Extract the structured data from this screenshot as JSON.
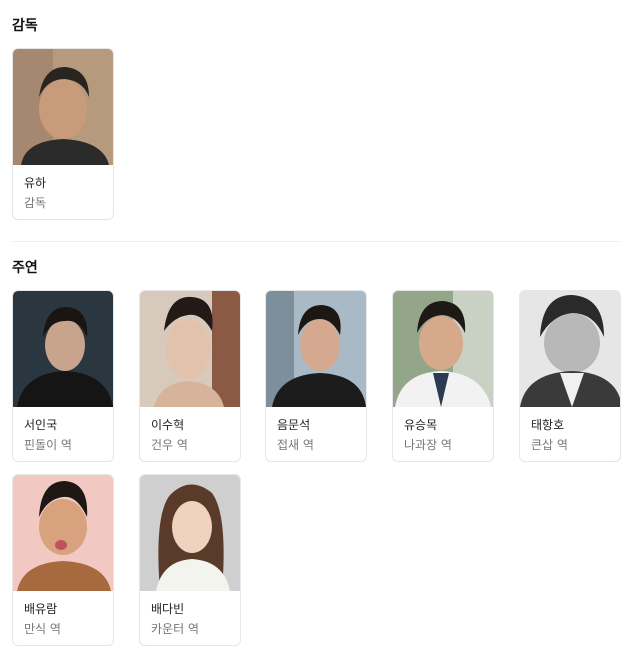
{
  "director_section": {
    "title": "감독",
    "people": [
      {
        "name": "유하",
        "role": "감독"
      }
    ]
  },
  "cast_section": {
    "title": "주연",
    "people": [
      {
        "name": "서인국",
        "role": "핀돌이 역"
      },
      {
        "name": "이수혁",
        "role": "건우 역"
      },
      {
        "name": "음문석",
        "role": "접새 역"
      },
      {
        "name": "유승목",
        "role": "나과장 역"
      },
      {
        "name": "태항호",
        "role": "큰삽 역"
      },
      {
        "name": "배유람",
        "role": "만식 역"
      },
      {
        "name": "배다빈",
        "role": "카운터 역"
      }
    ]
  }
}
